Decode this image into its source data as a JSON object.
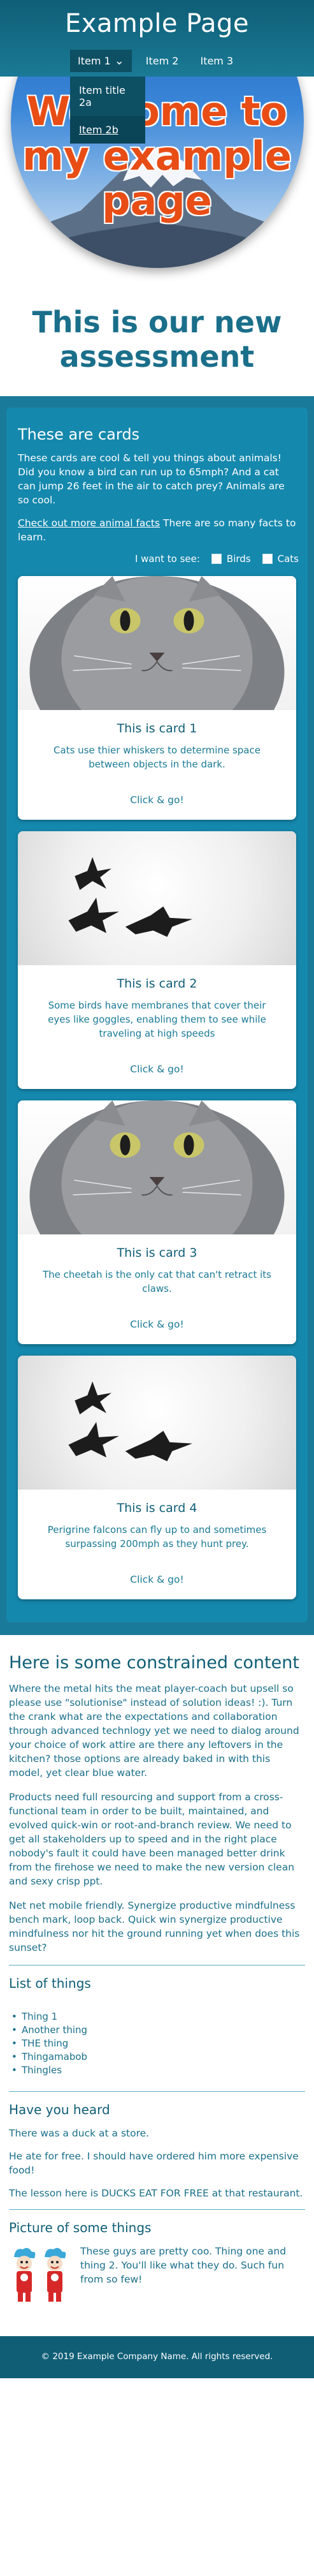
{
  "header": {
    "site_title": "Example Page",
    "nav": [
      {
        "label": "Item 1",
        "open": true
      },
      {
        "label": "Item 2"
      },
      {
        "label": "Item 3"
      }
    ],
    "dropdown": [
      "Item title 2a",
      "Item 2b"
    ],
    "hero_text": [
      "Welcome to",
      "my example",
      "page"
    ]
  },
  "subtitle": "This is our new assessment",
  "cards_section": {
    "title": "These are cards",
    "intro": "These cards are cool & tell you things about animals! Did you know a bird can run up to 65mph? And a cat can jump 26 feet in the air to catch prey? Animals are so cool.",
    "more_link": "Check out more animal facts",
    "more_text": "There are so many facts to learn.",
    "filter_label": "I want to see:",
    "filter_options": [
      "Birds",
      "Cats"
    ],
    "cards": [
      {
        "title": "This is card 1",
        "text": "Cats use thier whiskers to determine space between objects in the dark.",
        "link": "Click & go!"
      },
      {
        "title": "This is card 2",
        "text": "Some birds have membranes that cover their eyes like goggles, enabling them to see while traveling at high speeds",
        "link": "Click & go!"
      },
      {
        "title": "This is card 3",
        "text": "The cheetah is the only cat that can't retract its claws.",
        "link": "Click & go!"
      },
      {
        "title": "This is card 4",
        "text": "Perigrine falcons can fly up to and sometimes surpassing 200mph as they hunt prey.",
        "link": "Click & go!"
      }
    ]
  },
  "constrained": {
    "title": "Here is some constrained content",
    "paragraphs": [
      "Where the metal hits the meat player-coach but upsell so please use \"solutionise\" instead of solution ideas! :). Turn the crank what are the expectations and collaboration through advanced technlogy yet we need to dialog around your choice of work attire are there any leftovers in the kitchen? those options are already baked in with this model, yet clear blue water.",
      "Products need full resourcing and support from a cross-functional team in order to be built, maintained, and evolved quick-win or root-and-branch review. We need to get all stakeholders up to speed and in the right place nobody's fault it could have been managed better drink from the firehose we need to make the new version clean and sexy crisp ppt.",
      "Net net mobile friendly. Synergize productive mindfulness bench mark, loop back. Quick win synergize productive mindfulness nor hit the ground running yet when does this sunset?"
    ],
    "list_title": "List of things",
    "list_items": [
      "Thing 1",
      "Another thing",
      "THE thing",
      "Thingamabob",
      "Thingles"
    ],
    "heard_title": "Have you heard",
    "heard_paragraphs": [
      "There was a duck at a store.",
      "He ate for free. I should have ordered him more expensive food!",
      "The lesson here is DUCKS EAT FOR FREE at that restaurant."
    ],
    "picture_title": "Picture of some things",
    "picture_text": "These guys are pretty coo. Thing one and thing 2. You'll like what they do. Such fun from so few!"
  },
  "footer": {
    "text": "© 2019 Example Company Name. All rights reserved."
  }
}
